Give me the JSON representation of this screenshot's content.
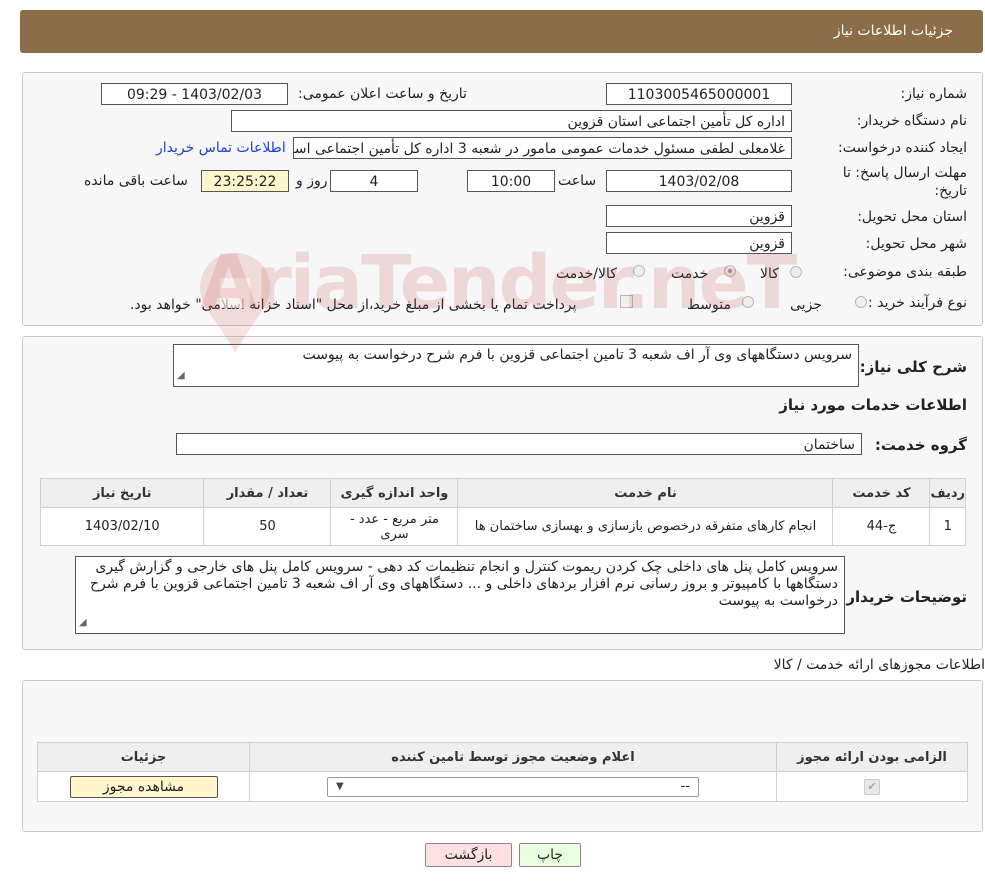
{
  "header": {
    "title": "جزئیات اطلاعات نیاز"
  },
  "form": {
    "need_number_label": "شماره نیاز:",
    "need_number": "1103005465000001",
    "announce_label": "تاریخ و ساعت اعلان عمومی:",
    "announce_value": "1403/02/03 - 09:29",
    "buyer_org_label": "نام دستگاه خریدار:",
    "buyer_org": "اداره کل تأمین اجتماعی استان قزوین",
    "creator_label": "ایجاد کننده درخواست:",
    "creator": "غلامعلی لطفی مسئول خدمات عمومی مامور در شعبه 3 اداره کل تأمین اجتماعی استان قزوین",
    "contact_link": "اطلاعات تماس خریدار",
    "deadline_label": "مهلت ارسال پاسخ: تا",
    "deadline_label2": "تاریخ:",
    "deadline_date": "1403/02/08",
    "time_label": "ساعت",
    "deadline_time": "10:00",
    "days_value": "4",
    "days_label": "روز و",
    "remaining_time": "23:25:22",
    "remaining_label": "ساعت باقی مانده",
    "province_label": "استان محل تحویل:",
    "province": "قزوین",
    "city_label": "شهر محل تحویل:",
    "city": "قزوین",
    "category_label": "طبقه بندی موضوعی:",
    "category_options": [
      "کالا",
      "خدمت",
      "کالا/خدمت"
    ],
    "category_selected": "خدمت",
    "process_label": "نوع فرآیند خرید :",
    "process_options": [
      "جزیی",
      "متوسط"
    ],
    "payment_note": "پرداخت تمام یا بخشی از مبلغ خرید،از محل \"اسناد خزانه اسلامی\" خواهد بود."
  },
  "summary": {
    "label": "شرح کلی نیاز:",
    "text": "سرویس دستگاههای وی آر اف شعبه 3 تامین اجتماعی قزوین با فرم شرح درخواست به پیوست"
  },
  "services": {
    "title": "اطلاعات خدمات مورد نیاز",
    "group_label": "گروه خدمت:",
    "group_value": "ساختمان",
    "columns": [
      "ردیف",
      "کد خدمت",
      "نام خدمت",
      "واحد اندازه گیری",
      "تعداد / مقدار",
      "تاریخ نیاز"
    ],
    "rows": [
      {
        "row": "1",
        "code": "ج-44",
        "name": "انجام کارهای متفرقه درخصوص بازسازی و بهسازی ساختمان ها",
        "unit": "متر مربع - عدد - سری",
        "qty": "50",
        "date": "1403/02/10"
      }
    ]
  },
  "buyer_notes": {
    "label": "توضیحات خریدار:",
    "text": "سرویس کامل پنل های داخلی چک کردن ریموت کنترل و انجام تنظیمات کد دهی - سرویس کامل پنل های خارجی و گزارش گیری دستگاهها با کامپیوتر و بروز رسانی نرم افزار بردهای داخلی و ... دستگاههای وی آر اف شعبه 3 تامین اجتماعی قزوین با فرم شرح درخواست به پیوست"
  },
  "permits": {
    "title": "اطلاعات مجوزهای ارائه خدمت / کالا",
    "columns": [
      "الزامی بودن ارائه مجوز",
      "اعلام وضعیت مجوز توسط تامین کننده",
      "جزئیات"
    ],
    "select_value": "--",
    "view_button": "مشاهده مجوز"
  },
  "actions": {
    "print": "چاپ",
    "back": "بازگشت"
  },
  "watermark": "AriaTender.neT"
}
